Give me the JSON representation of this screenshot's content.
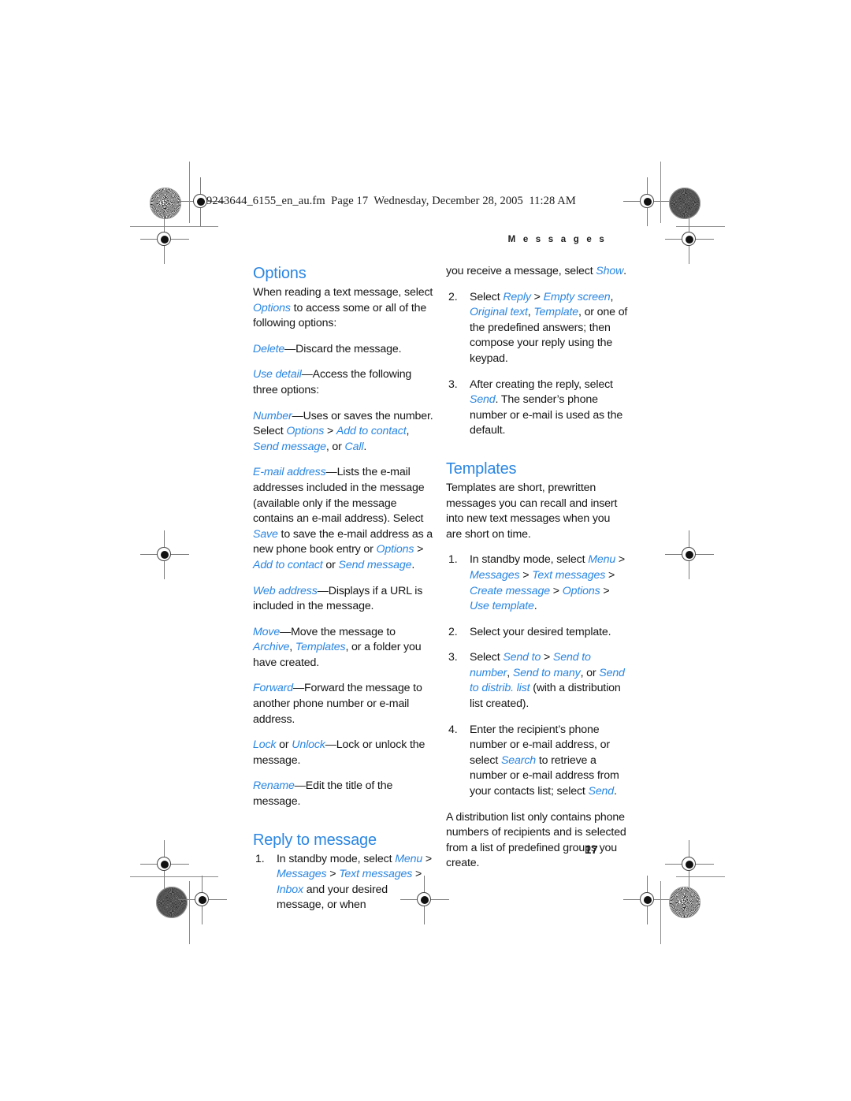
{
  "print_marks": {
    "file_slug": "9243644_6155_en_au.fm  Page 17  Wednesday, December 28, 2005  11:28 AM",
    "registration_icon": "registration-target-icon",
    "rosette_icon": "print-rosette-icon"
  },
  "running_head": "M e s s a g e s",
  "folio": "17",
  "left_column": {
    "heading_options": "Options",
    "paragraphs": [
      {
        "id": "intro",
        "runs": [
          {
            "text": "When reading a text message, select ",
            "style": "plain"
          },
          {
            "text": "Options",
            "style": "term"
          },
          {
            "text": " to access some or all of the following options:",
            "style": "plain"
          }
        ]
      },
      {
        "id": "delete",
        "runs": [
          {
            "text": "Delete",
            "style": "term"
          },
          {
            "text": "—Discard the message.",
            "style": "plain"
          }
        ]
      },
      {
        "id": "use-detail",
        "runs": [
          {
            "text": "Use detail",
            "style": "term"
          },
          {
            "text": "—Access the following three options:",
            "style": "plain"
          }
        ]
      },
      {
        "id": "number",
        "runs": [
          {
            "text": "Number",
            "style": "term"
          },
          {
            "text": "—Uses or saves the number. Select ",
            "style": "plain"
          },
          {
            "text": "Options",
            "style": "term"
          },
          {
            "text": " > ",
            "style": "plain"
          },
          {
            "text": "Add to contact",
            "style": "term"
          },
          {
            "text": ", ",
            "style": "plain"
          },
          {
            "text": "Send message",
            "style": "term"
          },
          {
            "text": ", or ",
            "style": "plain"
          },
          {
            "text": "Call",
            "style": "term"
          },
          {
            "text": ".",
            "style": "plain"
          }
        ]
      },
      {
        "id": "email-address",
        "runs": [
          {
            "text": "E-mail address",
            "style": "term"
          },
          {
            "text": "—Lists the e-mail addresses included in the message (available only if the message contains an e-mail address). Select ",
            "style": "plain"
          },
          {
            "text": "Save",
            "style": "term"
          },
          {
            "text": " to save the e-mail address as a new phone book entry or ",
            "style": "plain"
          },
          {
            "text": "Options",
            "style": "term"
          },
          {
            "text": " > ",
            "style": "plain"
          },
          {
            "text": "Add to contact",
            "style": "term"
          },
          {
            "text": " or ",
            "style": "plain"
          },
          {
            "text": "Send message",
            "style": "term"
          },
          {
            "text": ".",
            "style": "plain"
          }
        ]
      },
      {
        "id": "web-address",
        "runs": [
          {
            "text": "Web address",
            "style": "term"
          },
          {
            "text": "—Displays if a URL is included in the message.",
            "style": "plain"
          }
        ]
      },
      {
        "id": "move",
        "runs": [
          {
            "text": "Move",
            "style": "term"
          },
          {
            "text": "—Move the message to ",
            "style": "plain"
          },
          {
            "text": "Archive",
            "style": "term"
          },
          {
            "text": ", ",
            "style": "plain"
          },
          {
            "text": "Templates",
            "style": "term"
          },
          {
            "text": ", or a folder you have created.",
            "style": "plain"
          }
        ]
      },
      {
        "id": "forward",
        "runs": [
          {
            "text": "Forward",
            "style": "term"
          },
          {
            "text": "—Forward the message to another phone number or e-mail address.",
            "style": "plain"
          }
        ]
      },
      {
        "id": "lock",
        "runs": [
          {
            "text": "Lock",
            "style": "term"
          },
          {
            "text": " or ",
            "style": "plain"
          },
          {
            "text": "Unlock",
            "style": "term"
          },
          {
            "text": "—Lock or unlock the message.",
            "style": "plain"
          }
        ]
      },
      {
        "id": "rename",
        "runs": [
          {
            "text": "Rename",
            "style": "term"
          },
          {
            "text": "—Edit the title of the message.",
            "style": "plain"
          }
        ]
      }
    ],
    "heading_reply": "Reply to message",
    "reply_step_1": {
      "runs": [
        {
          "text": "In standby mode, select ",
          "style": "plain"
        },
        {
          "text": "Menu",
          "style": "term"
        },
        {
          "text": " > ",
          "style": "plain"
        },
        {
          "text": "Messages",
          "style": "term"
        },
        {
          "text": " > ",
          "style": "plain"
        },
        {
          "text": "Text messages",
          "style": "term"
        },
        {
          "text": " > ",
          "style": "plain"
        },
        {
          "text": "Inbox",
          "style": "term"
        },
        {
          "text": " and your desired message, or when",
          "style": "plain"
        }
      ]
    }
  },
  "right_column": {
    "reply_continued": {
      "runs": [
        {
          "text": "you receive a message, select ",
          "style": "plain"
        },
        {
          "text": "Show",
          "style": "term"
        },
        {
          "text": ".",
          "style": "plain"
        }
      ]
    },
    "reply_steps": [
      {
        "number": "2.",
        "runs": [
          {
            "text": "Select ",
            "style": "plain"
          },
          {
            "text": "Reply",
            "style": "term"
          },
          {
            "text": " > ",
            "style": "plain"
          },
          {
            "text": "Empty screen",
            "style": "term"
          },
          {
            "text": ", ",
            "style": "plain"
          },
          {
            "text": "Original text",
            "style": "term"
          },
          {
            "text": ", ",
            "style": "plain"
          },
          {
            "text": "Template",
            "style": "term"
          },
          {
            "text": ", or one of the predefined answers; then compose your reply using the keypad.",
            "style": "plain"
          }
        ]
      },
      {
        "number": "3.",
        "runs": [
          {
            "text": "After creating the reply, select ",
            "style": "plain"
          },
          {
            "text": "Send",
            "style": "term"
          },
          {
            "text": ". The sender’s phone number or e-mail is used as the default.",
            "style": "plain"
          }
        ]
      }
    ],
    "heading_templates": "Templates",
    "templates_intro": {
      "runs": [
        {
          "text": "Templates are short, prewritten messages you can recall and insert into new text messages when you are short on time.",
          "style": "plain"
        }
      ]
    },
    "templates_steps": [
      {
        "number": "1.",
        "runs": [
          {
            "text": "In standby mode, select ",
            "style": "plain"
          },
          {
            "text": "Menu",
            "style": "term"
          },
          {
            "text": " > ",
            "style": "plain"
          },
          {
            "text": "Messages",
            "style": "term"
          },
          {
            "text": " > ",
            "style": "plain"
          },
          {
            "text": "Text messages",
            "style": "term"
          },
          {
            "text": " > ",
            "style": "plain"
          },
          {
            "text": "Create message",
            "style": "term"
          },
          {
            "text": " > ",
            "style": "plain"
          },
          {
            "text": "Options",
            "style": "term"
          },
          {
            "text": " > ",
            "style": "plain"
          },
          {
            "text": "Use template",
            "style": "term"
          },
          {
            "text": ".",
            "style": "plain"
          }
        ]
      },
      {
        "number": "2.",
        "runs": [
          {
            "text": "Select your desired template.",
            "style": "plain"
          }
        ]
      },
      {
        "number": "3.",
        "runs": [
          {
            "text": "Select ",
            "style": "plain"
          },
          {
            "text": "Send to",
            "style": "term"
          },
          {
            "text": " > ",
            "style": "plain"
          },
          {
            "text": "Send to number",
            "style": "term"
          },
          {
            "text": ", ",
            "style": "plain"
          },
          {
            "text": "Send to many",
            "style": "term"
          },
          {
            "text": ", or ",
            "style": "plain"
          },
          {
            "text": "Send to distrib. list",
            "style": "term"
          },
          {
            "text": " (with a distribution list created).",
            "style": "plain"
          }
        ]
      },
      {
        "number": "4.",
        "runs": [
          {
            "text": "Enter the recipient’s phone number or e-mail address, or select ",
            "style": "plain"
          },
          {
            "text": "Search",
            "style": "term"
          },
          {
            "text": " to retrieve a number or e-mail address from your contacts list; select ",
            "style": "plain"
          },
          {
            "text": "Send",
            "style": "term"
          },
          {
            "text": ".",
            "style": "plain"
          }
        ]
      }
    ],
    "closing_paragraph": {
      "runs": [
        {
          "text": "A distribution list only contains phone numbers of recipients and is selected from a list of predefined groups you create.",
          "style": "plain"
        }
      ]
    }
  },
  "colors": {
    "accent_blue": "#2a86e2",
    "body_text": "#161616"
  }
}
